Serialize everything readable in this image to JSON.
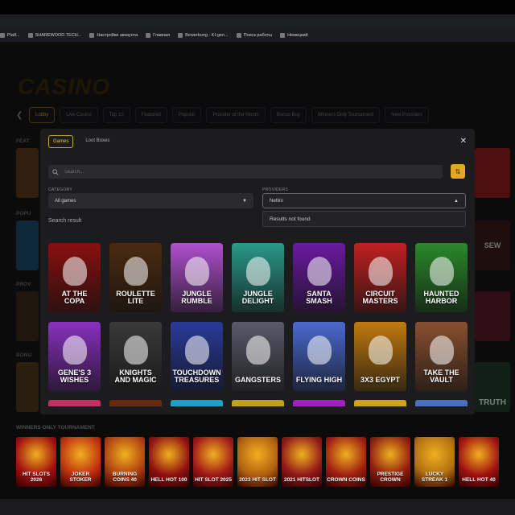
{
  "bookmarks": [
    {
      "label": "Platf...",
      "icon": "page-icon"
    },
    {
      "label": "SHAREWOOD.TECH...",
      "icon": "page-icon"
    },
    {
      "label": "Настройки аккаунта",
      "icon": "page-icon"
    },
    {
      "label": "Главная",
      "icon": "page-icon"
    },
    {
      "label": "Bewerbung - KI-gen...",
      "icon": "page-icon"
    },
    {
      "label": "Поиск работы",
      "icon": "folder-icon"
    },
    {
      "label": "Немецкий",
      "icon": "folder-icon"
    }
  ],
  "site": {
    "logo": "CASINO",
    "categories": [
      "Lobby",
      "Live Casino",
      "Top 10",
      "Featured",
      "Popular",
      "Provider of the Month",
      "Bonus Buy",
      "Winners Only Tournament",
      "New Providers"
    ],
    "sections": {
      "featured": "FEAT",
      "popular": "POPU",
      "providers": "PROV",
      "bonus": "BONU",
      "winners": "WINNERS ONLY TOURNAMENT"
    },
    "side_right": [
      "SEW",
      "TRUTH"
    ]
  },
  "modal": {
    "tabs": [
      {
        "label": "Games",
        "active": true
      },
      {
        "label": "Loot Boxes",
        "active": false
      }
    ],
    "search_placeholder": "Search...",
    "category_label": "CATEGORY",
    "category_value": "All games",
    "providers_label": "PROVIDERS",
    "providers_value": "Netlini",
    "dropdown_text": "Results not found",
    "search_result_label": "Search result",
    "games": [
      {
        "title": "AT THE COPA",
        "color": "#8a1010"
      },
      {
        "title": "ROULETTE LITE",
        "color": "#4a2a10"
      },
      {
        "title": "JUNGLE RUMBLE",
        "color": "#b050d0"
      },
      {
        "title": "JUNGLE DELIGHT",
        "color": "#2a9a8a"
      },
      {
        "title": "SANTA SMASH",
        "color": "#6a1aa0"
      },
      {
        "title": "CIRCUIT MASTERS",
        "color": "#c02020"
      },
      {
        "title": "HAUNTED HARBOR",
        "color": "#2a8a2a"
      },
      {
        "title": "GENE'S 3 WISHES",
        "color": "#8a30c0"
      },
      {
        "title": "KNIGHTS AND MAGIC",
        "color": "#3a3a3a"
      },
      {
        "title": "TOUCHDOWN TREASURES",
        "color": "#2a3a9a"
      },
      {
        "title": "GANGSTERS",
        "color": "#5a5a6a"
      },
      {
        "title": "FLYING HIGH",
        "color": "#4a6ad0"
      },
      {
        "title": "3X3 EGYPT",
        "color": "#c07a10"
      },
      {
        "title": "TAKE THE VAULT",
        "color": "#8a5030"
      }
    ],
    "next_row_colors": [
      "#c03060",
      "#6a2a10",
      "#20a0c0",
      "#c0a020",
      "#a020c0",
      "#d0a020",
      "#4a70c0"
    ]
  },
  "winners_games": [
    {
      "title": "HIT SLOTS 2026",
      "color": "#a01010"
    },
    {
      "title": "JOKER STOKER",
      "color": "#c03010"
    },
    {
      "title": "BURNING COINS 40",
      "color": "#b04010"
    },
    {
      "title": "HELL HOT 100",
      "color": "#901010"
    },
    {
      "title": "HIT SLOT 2025",
      "color": "#a01818"
    },
    {
      "title": "2023 HIT SLOT",
      "color": "#b06010"
    },
    {
      "title": "2021 HITSLOT",
      "color": "#901818"
    },
    {
      "title": "CROWN COINS",
      "color": "#a02010"
    },
    {
      "title": "PRESTIGE CROWN",
      "color": "#902010"
    },
    {
      "title": "LUCKY STREAK 1",
      "color": "#b07010"
    },
    {
      "title": "HELL HOT 40",
      "color": "#a01010"
    }
  ]
}
